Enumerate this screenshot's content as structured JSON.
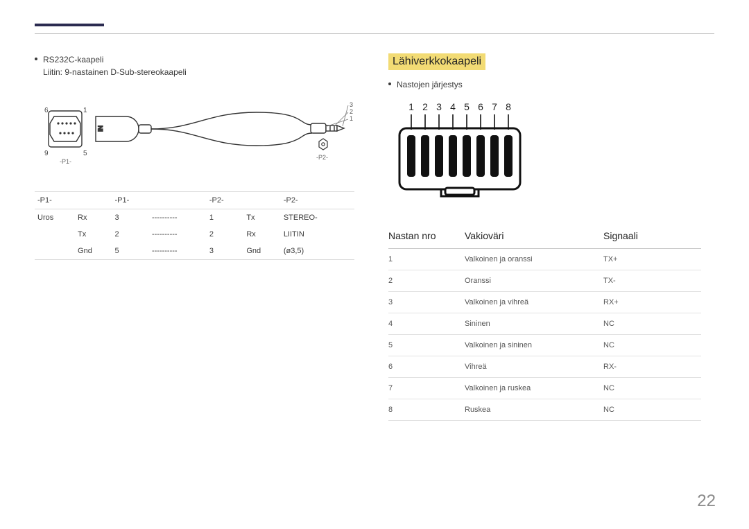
{
  "left": {
    "title": "RS232C-kaapeli",
    "subtitle": "Liitin: 9-nastainen D-Sub-stereokaapeli",
    "fig": {
      "p1_label": "-P1-",
      "p2_label": "-P2-",
      "pin_nums_left": [
        "6",
        "1",
        "9",
        "5"
      ],
      "jack_nums": [
        "3",
        "2",
        "1"
      ],
      "in_label": "IN"
    },
    "table": {
      "head": [
        "-P1-",
        "",
        "-P1-",
        "",
        "-P2-",
        "",
        "-P2-"
      ],
      "rows": [
        [
          "Uros",
          "Rx",
          "3",
          "----------",
          "1",
          "Tx",
          "STEREO-"
        ],
        [
          "",
          "Tx",
          "2",
          "----------",
          "2",
          "Rx",
          "LIITIN"
        ],
        [
          "",
          "Gnd",
          "5",
          "----------",
          "3",
          "Gnd",
          "(ø3,5)"
        ]
      ]
    }
  },
  "right": {
    "section": "Lähiverkkokaapeli",
    "bullet": "Nastojen järjestys",
    "rj45_nums": [
      "1",
      "2",
      "3",
      "4",
      "5",
      "6",
      "7",
      "8"
    ],
    "headers": [
      "Nastan nro",
      "Vakioväri",
      "Signaali"
    ],
    "rows": [
      [
        "1",
        "Valkoinen ja oranssi",
        "TX+"
      ],
      [
        "2",
        "Oranssi",
        "TX-"
      ],
      [
        "3",
        "Valkoinen ja vihreä",
        "RX+"
      ],
      [
        "4",
        "Sininen",
        "NC"
      ],
      [
        "5",
        "Valkoinen ja sininen",
        "NC"
      ],
      [
        "6",
        "Vihreä",
        "RX-"
      ],
      [
        "7",
        "Valkoinen ja ruskea",
        "NC"
      ],
      [
        "8",
        "Ruskea",
        "NC"
      ]
    ]
  },
  "page_number": "22"
}
